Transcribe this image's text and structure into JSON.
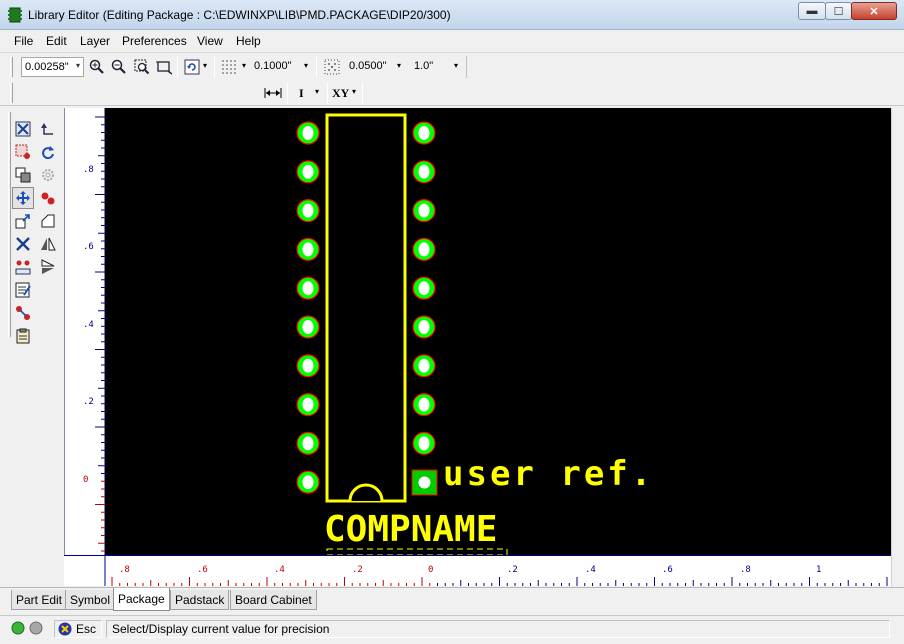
{
  "window": {
    "title": "Library Editor (Editing Package : C:\\EDWINXP\\LIB\\PMD.PACKAGE\\DIP20/300)",
    "minimize_glyph": "▬",
    "maximize_glyph": "☐",
    "close_glyph": "✕"
  },
  "menu": [
    "File",
    "Edit",
    "Layer",
    "Preferences",
    "View",
    "Help"
  ],
  "toolbar": {
    "precision": "0.00258\"",
    "grid_x": "0.1000\"",
    "snap": "0.0500\"",
    "zoom_factor": "1.0\"",
    "arrow": "▾",
    "text_mode": "I",
    "coord_mode": "XY"
  },
  "palette": {
    "icons": [
      "select-icon",
      "undo-icon",
      "block-icon",
      "rotate-icon",
      "copy-icon",
      "gear-icon",
      "move-icon",
      "pads-icon",
      "resize-icon",
      "draw-shape-icon",
      "delete-icon",
      "mirror-vertical-icon",
      "explode-icon",
      "mirror-horizontal-icon",
      "properties-icon",
      "connect-icon",
      "clipboard-icon"
    ]
  },
  "canvas": {
    "ref_label": "user ref.",
    "name_label": "COMPNAME",
    "colors": {
      "background": "#000000",
      "outline": "#ffff00",
      "pad_ring": "#00ff00",
      "pad_hole": "#ffffff",
      "pad_edge": "#ff0000"
    },
    "pins_per_side": 10
  },
  "rulers": {
    "left_labels": [
      ".8",
      ".6",
      ".4",
      ".2",
      "0"
    ],
    "bottom_labels": [
      ".8",
      ".6",
      ".4",
      ".2",
      "0",
      ".2",
      ".4",
      ".6",
      ".8",
      "1"
    ]
  },
  "tabs": [
    "Part Edit",
    "Symbol",
    "Package",
    "Padstack",
    "Board Cabinet"
  ],
  "active_tab": "Package",
  "status": {
    "esc_label": "Esc",
    "message": "Select/Display current value for precision"
  }
}
